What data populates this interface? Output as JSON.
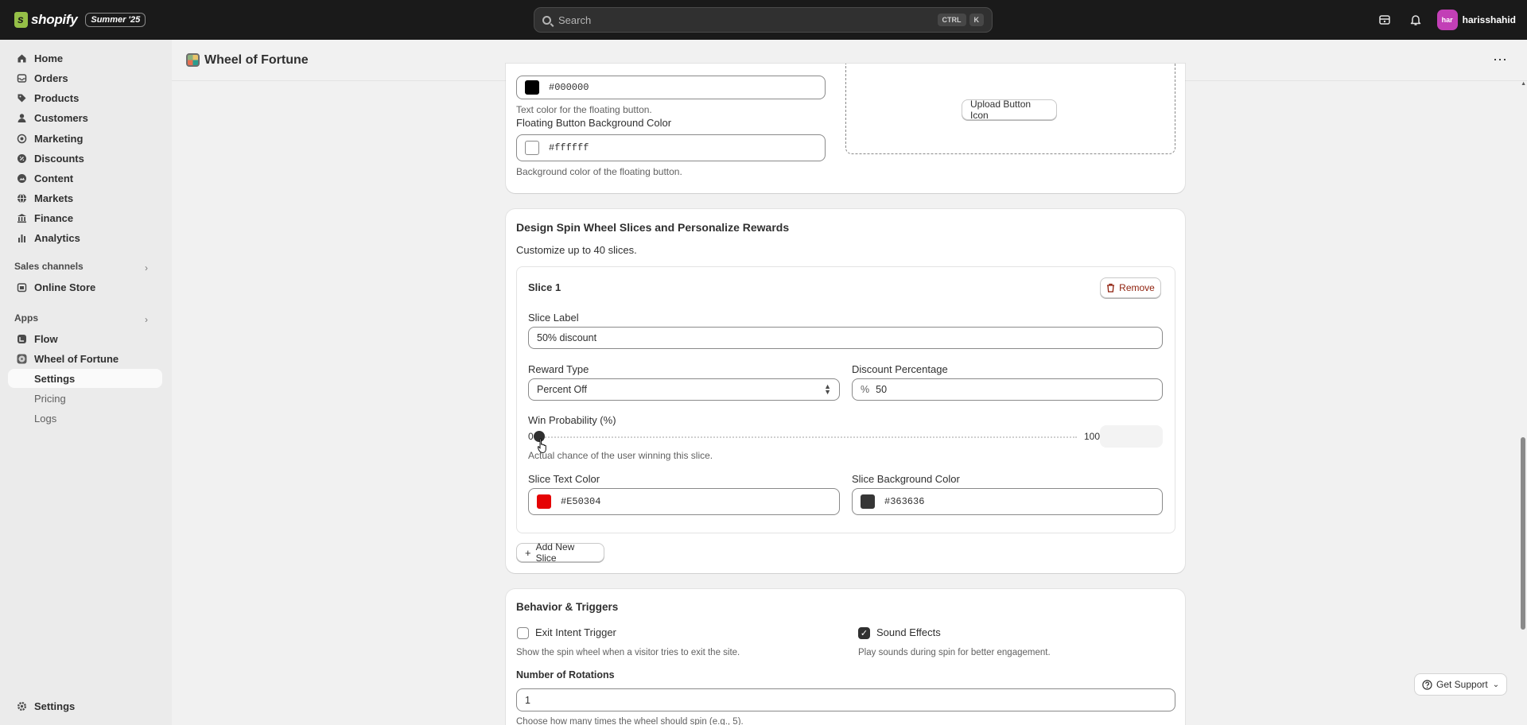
{
  "topbar": {
    "brand": "shopify",
    "edition_badge": "Summer '25",
    "search_placeholder": "Search",
    "shortcut_keys": [
      "CTRL",
      "K"
    ],
    "avatar_initials": "har",
    "username": "harisshahid"
  },
  "sidebar": {
    "items": [
      {
        "label": "Home",
        "icon": "home-icon"
      },
      {
        "label": "Orders",
        "icon": "inbox-icon"
      },
      {
        "label": "Products",
        "icon": "tag-icon"
      },
      {
        "label": "Customers",
        "icon": "person-icon"
      },
      {
        "label": "Marketing",
        "icon": "target-icon"
      },
      {
        "label": "Discounts",
        "icon": "discount-icon"
      },
      {
        "label": "Content",
        "icon": "content-icon"
      },
      {
        "label": "Markets",
        "icon": "globe-icon"
      },
      {
        "label": "Finance",
        "icon": "bank-icon"
      },
      {
        "label": "Analytics",
        "icon": "chart-icon"
      }
    ],
    "sales_channels_label": "Sales channels",
    "online_store": "Online Store",
    "apps_label": "Apps",
    "apps": {
      "flow": "Flow",
      "wheel": "Wheel of Fortune",
      "sub": [
        "Settings",
        "Pricing",
        "Logs"
      ]
    },
    "settings": "Settings"
  },
  "page": {
    "title": "Wheel of Fortune"
  },
  "button_card": {
    "text_color_value": "#000000",
    "text_color_help": "Text color for the floating button.",
    "bg_color_label": "Floating Button Background Color",
    "bg_color_value": "#ffffff",
    "bg_color_help": "Background color of the floating button.",
    "upload_button": "Upload Button Icon"
  },
  "slices_card": {
    "title": "Design Spin Wheel Slices and Personalize Rewards",
    "subtitle": "Customize up to 40 slices.",
    "slice": {
      "name": "Slice 1",
      "remove": "Remove",
      "label_label": "Slice Label",
      "label_value": "50% discount",
      "reward_type_label": "Reward Type",
      "reward_type_value": "Percent Off",
      "discount_label": "Discount Percentage",
      "discount_prefix": "%",
      "discount_value": "50",
      "win_prob_label": "Win Probability (%)",
      "win_prob_min": "0",
      "win_prob_max": "100",
      "win_prob_value": 0,
      "win_prob_help": "Actual chance of the user winning this slice.",
      "text_color_label": "Slice Text Color",
      "text_color_value": "#E50304",
      "bg_color_label": "Slice Background Color",
      "bg_color_value": "#363636"
    },
    "add_slice": "Add New Slice"
  },
  "behavior_card": {
    "title": "Behavior & Triggers",
    "exit_intent_label": "Exit Intent Trigger",
    "exit_intent_checked": false,
    "exit_intent_help": "Show the spin wheel when a visitor tries to exit the site.",
    "sound_label": "Sound Effects",
    "sound_checked": true,
    "sound_help": "Play sounds during spin for better engagement.",
    "rotations_label": "Number of Rotations",
    "rotations_value": "1",
    "rotations_help": "Choose how many times the wheel should spin (e.g., 5)."
  },
  "support": "Get Support",
  "colors": {
    "accent_dark": "#303030",
    "topbar": "#1a1a1a",
    "remove_text": "#8e1f0b",
    "swatch_black": "#000000",
    "swatch_white": "#ffffff",
    "swatch_red": "#E50304",
    "swatch_dark": "#363636"
  }
}
